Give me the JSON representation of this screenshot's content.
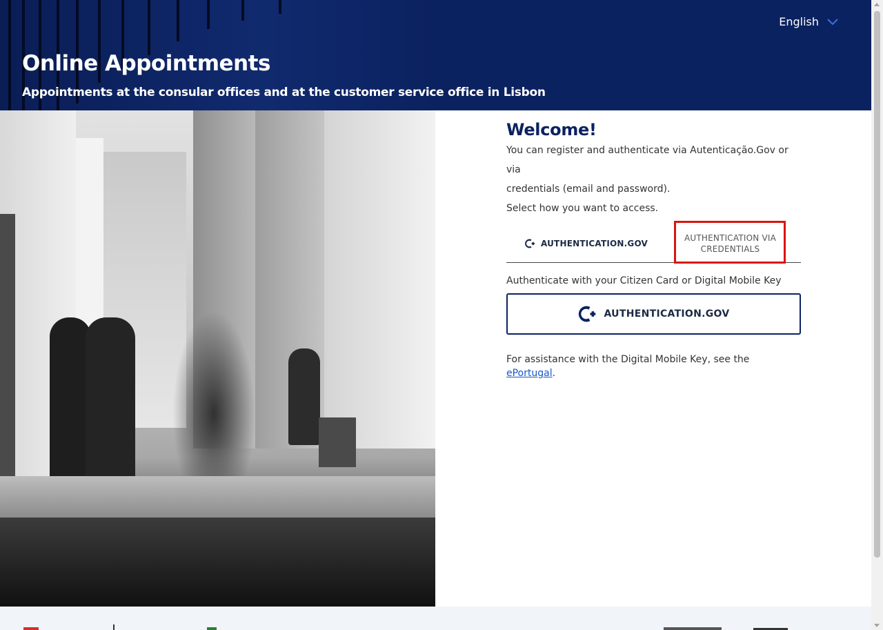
{
  "header": {
    "language": "English",
    "title": "Online Appointments",
    "subtitle": "Appointments at the consular offices and at the customer service office in Lisbon"
  },
  "main": {
    "welcome": "Welcome!",
    "intro_line1": "You can register and authenticate via Autenticação.Gov or via",
    "intro_line2": "credentials (email and password).",
    "intro_line3": "Select how you want to access.",
    "tabs": [
      {
        "label": "AUTHENTICATION.GOV"
      },
      {
        "label_line1": "AUTHENTICATION VIA",
        "label_line2": "CREDENTIALS"
      }
    ],
    "hint": "Authenticate with your Citizen Card or Digital Mobile Key",
    "auth_button_label": "AUTHENTICATION.GOV",
    "assist_text": "For assistance with the Digital Mobile Key, see the ",
    "assist_link": "ePortugal",
    "assist_end": "."
  },
  "colors": {
    "brand_navy": "#0b2260",
    "link": "#1757c8",
    "highlight": "#d9140e"
  },
  "icons": {
    "language_dropdown": "chevron-down-icon",
    "gov_auth": "autenticacao-gov-icon"
  }
}
